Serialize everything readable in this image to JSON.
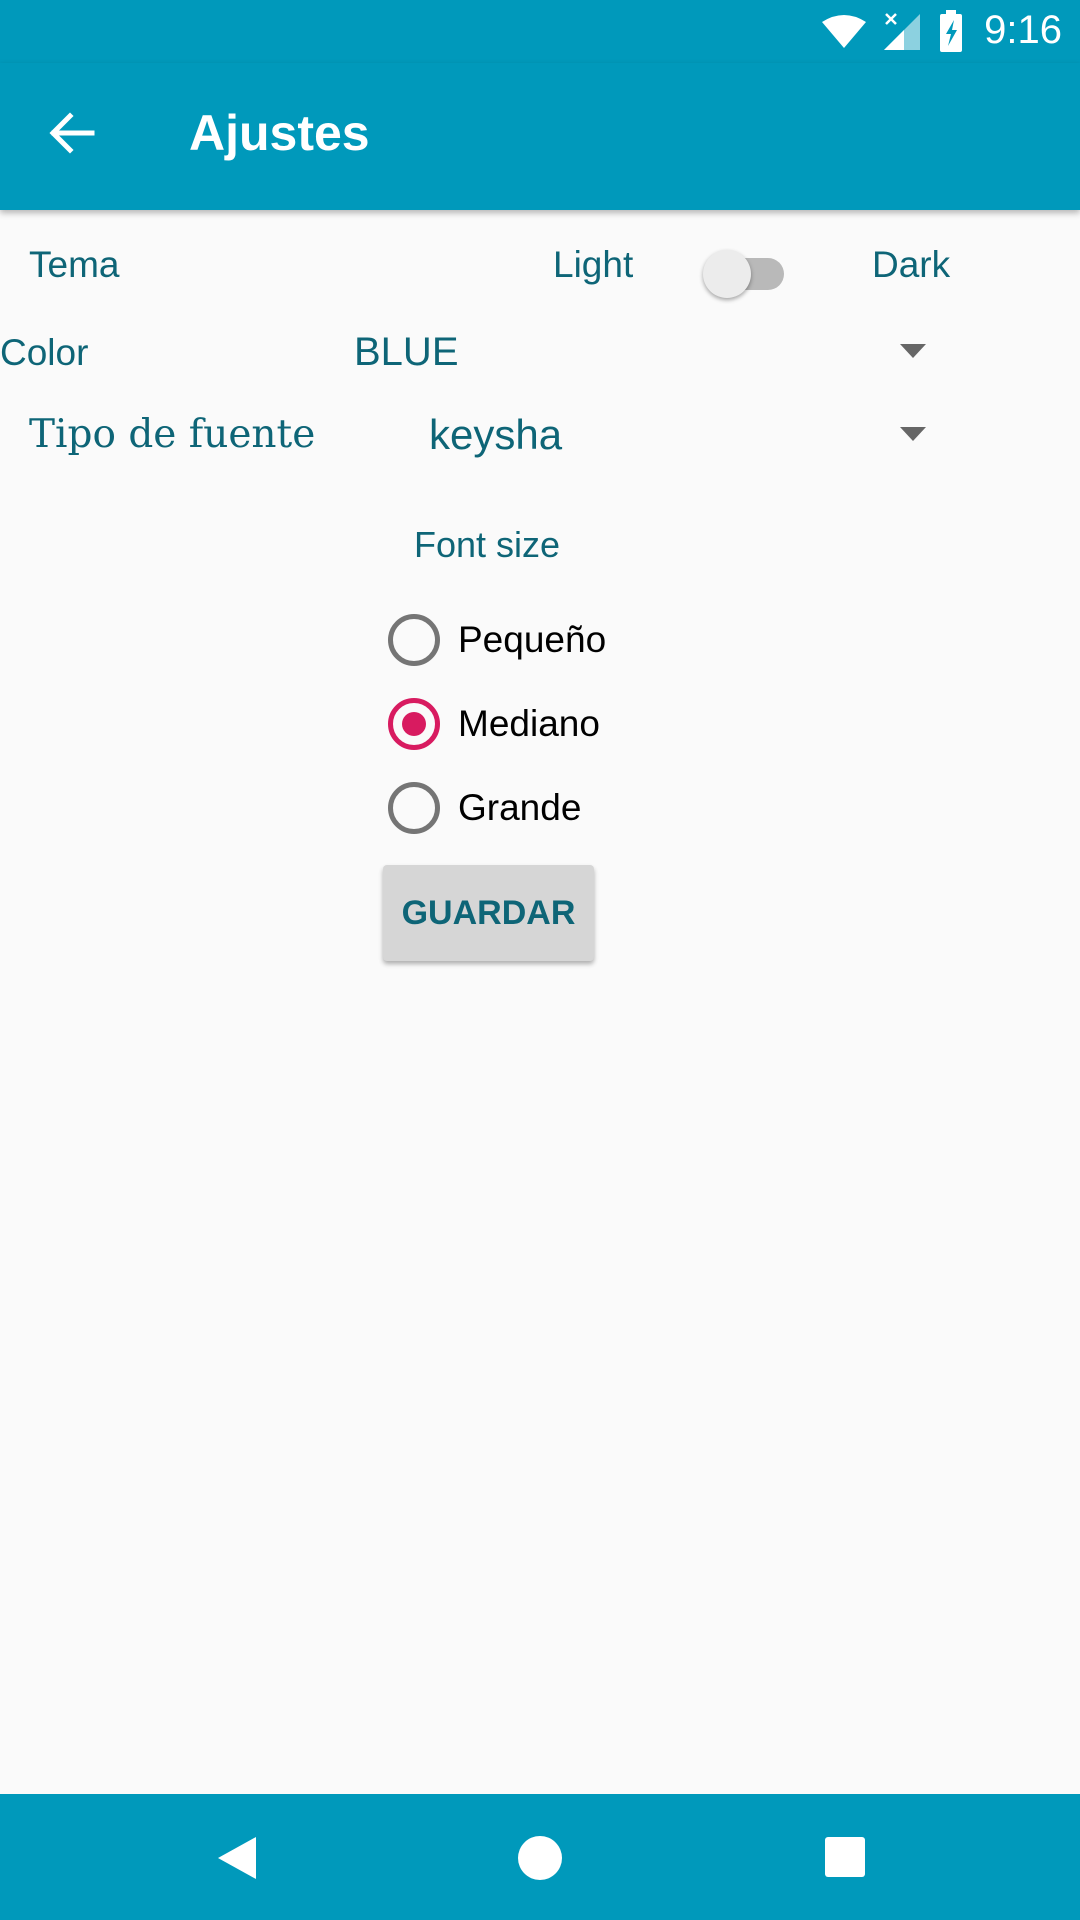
{
  "status_bar": {
    "time": "9:16",
    "icons": [
      "wifi-icon",
      "signal-icon",
      "battery-charging-icon"
    ]
  },
  "app_bar": {
    "back_icon": "arrow-back-icon",
    "title": "Ajustes"
  },
  "settings": {
    "theme": {
      "label": "Tema",
      "left_option": "Light",
      "right_option": "Dark",
      "dark_enabled": false
    },
    "color": {
      "label": "Color",
      "value": "BLUE"
    },
    "font_type": {
      "label": "Tipo de fuente",
      "value": "keysha"
    },
    "font_size": {
      "label": "Font size",
      "options": [
        {
          "label": "Pequeño",
          "selected": false
        },
        {
          "label": "Mediano",
          "selected": true
        },
        {
          "label": "Grande",
          "selected": false
        }
      ]
    },
    "save_label": "GUARDAR"
  },
  "colors": {
    "primary": "#0099bb",
    "text_teal": "#0e6577",
    "accent": "#d81b60"
  },
  "nav_bar": {
    "icons": [
      "nav-back-icon",
      "nav-home-icon",
      "nav-recents-icon"
    ]
  }
}
